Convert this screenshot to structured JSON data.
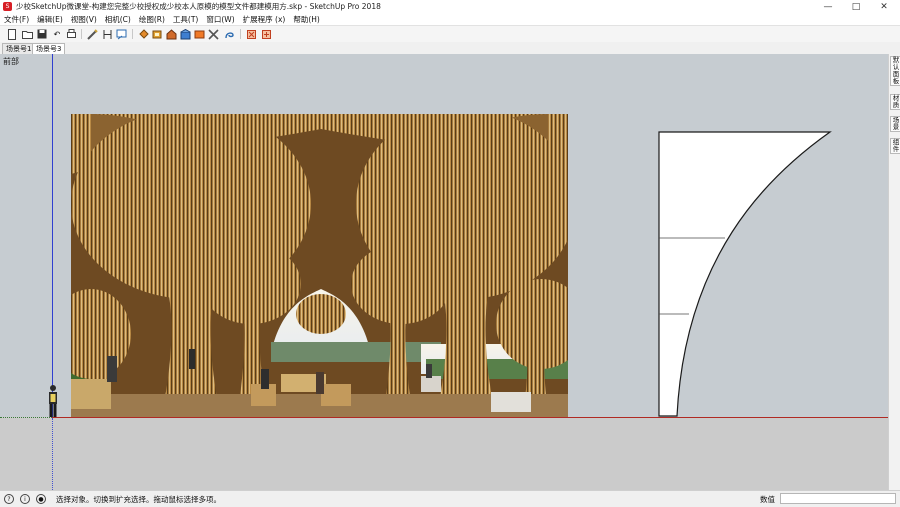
{
  "window": {
    "title": "少校SketchUp微课堂-构建您完整少校授权成少校本人原模的模型文件都建模用方.skp - SketchUp Pro 2018",
    "app_icon_letter": "S"
  },
  "menu": [
    {
      "label": "文件(F)"
    },
    {
      "label": "编辑(E)"
    },
    {
      "label": "视图(V)"
    },
    {
      "label": "相机(C)"
    },
    {
      "label": "绘图(R)"
    },
    {
      "label": "工具(T)"
    },
    {
      "label": "窗口(W)"
    },
    {
      "label": "扩展程序 (x)"
    },
    {
      "label": "帮助(H)"
    }
  ],
  "scene_tabs": [
    {
      "label": "场景号1",
      "active": false
    },
    {
      "label": "场景号3",
      "active": true
    }
  ],
  "viewport": {
    "label": "前部"
  },
  "right_panel_tabs": [
    {
      "label": "默认面板"
    },
    {
      "label": "材质"
    },
    {
      "label": "场景"
    },
    {
      "label": "组件"
    }
  ],
  "status": {
    "text": "选择对象。切换到扩充选择。拖动鼠标选择多项。",
    "measure_label": "数值",
    "measure_value": ""
  }
}
